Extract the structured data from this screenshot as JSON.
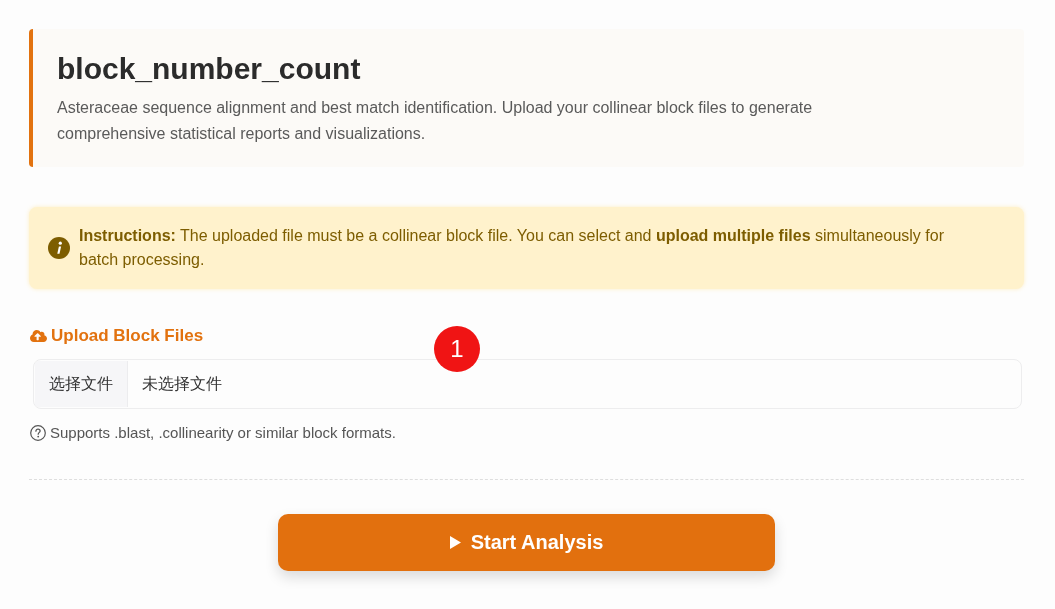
{
  "header": {
    "title": "block_number_count",
    "description": "Asteraceae sequence alignment and best match identification. Upload your collinear block files to generate comprehensive statistical reports and visualizations."
  },
  "notice": {
    "text": "**Instructions:** The uploaded file must be a collinear block file. You can select and **upload multiple files** simultaneously for batch processing."
  },
  "upload": {
    "label": "Upload Block Files",
    "choose_button": "选择文件",
    "file_status": "未选择文件",
    "hint": "Supports .blast, .collinearity or similar block formats."
  },
  "marker": {
    "label": "1"
  },
  "start_button": {
    "label": "Start Analysis"
  }
}
